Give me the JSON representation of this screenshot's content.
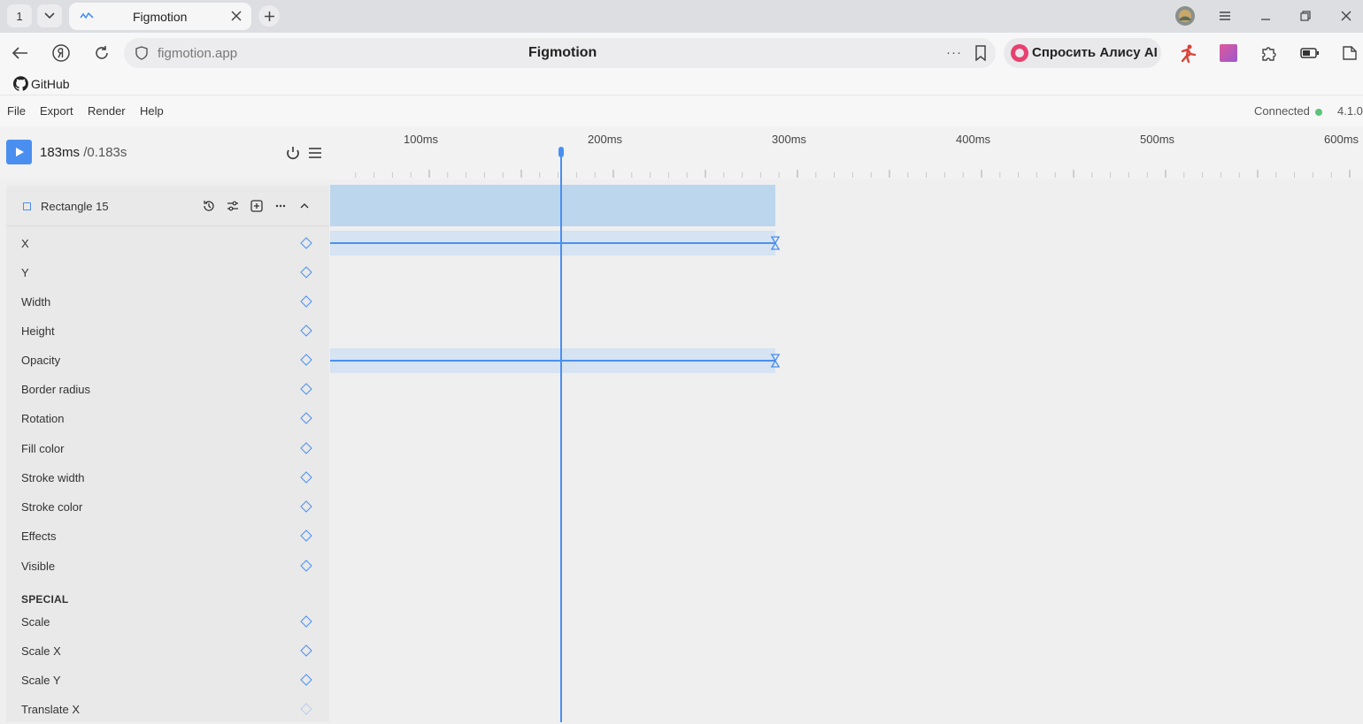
{
  "browser": {
    "tab_count": "1",
    "tab_title": "Figmotion",
    "url": "figmotion.app",
    "page_title": "Figmotion",
    "more_glyph": "···",
    "alice_label": "Спросить Алису AI"
  },
  "app": {
    "github_label": "GitHub",
    "menu": [
      "File",
      "Export",
      "Render",
      "Help"
    ],
    "status": "Connected",
    "version": "4.1.0",
    "accent_color": "#4a8ff0",
    "status_color": "#5cc37a"
  },
  "transport": {
    "current_ms": "183ms",
    "current_s": " /0.183s"
  },
  "ruler": {
    "labels": [
      "100ms",
      "200ms",
      "300ms",
      "400ms",
      "500ms",
      "600ms"
    ]
  },
  "layer": {
    "name": "Rectangle 15"
  },
  "properties": [
    "X",
    "Y",
    "Width",
    "Height",
    "Opacity",
    "Border radius",
    "Rotation",
    "Fill color",
    "Stroke width",
    "Stroke color",
    "Effects",
    "Visible"
  ],
  "special_title": "SPECIAL",
  "special_properties": [
    "Scale",
    "Scale X",
    "Scale Y",
    "Translate X"
  ],
  "timeline": {
    "playhead_ms": 183,
    "layer_duration_ms": 300,
    "animated_tracks": [
      "X",
      "Opacity"
    ]
  }
}
